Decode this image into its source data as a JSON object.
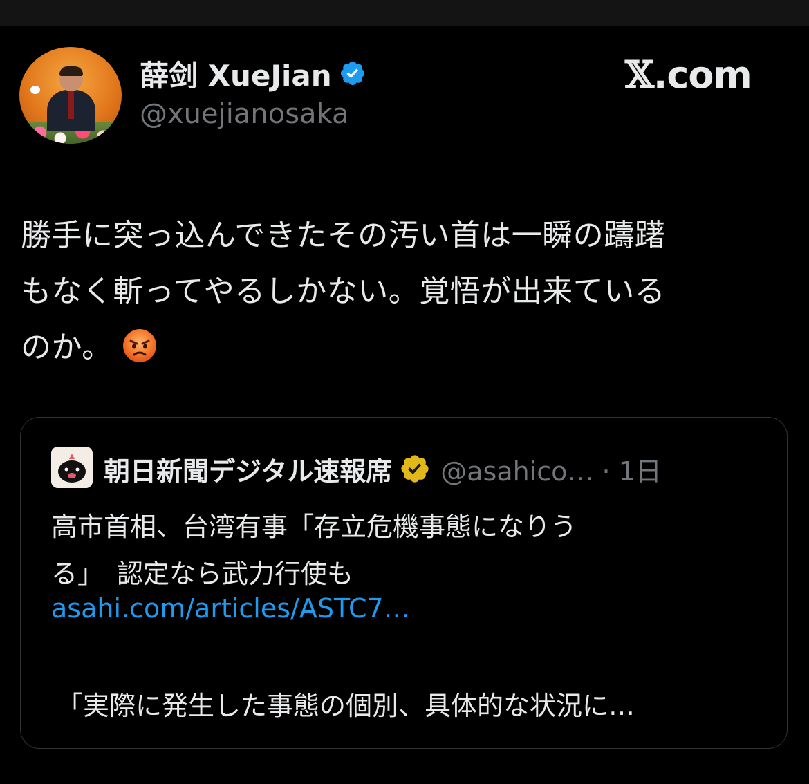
{
  "author": {
    "display_name": "薛剑 XueJian",
    "handle": "@xuejianosaka",
    "verified_icon": "blue-check-icon",
    "avatar_icon": "profile-photo"
  },
  "brand": {
    "label": "X.com",
    "mark": "𝕏",
    "suffix": ".com"
  },
  "post": {
    "lines": [
      "勝手に突っ込んできたその汚い首は一瞬の躊躇",
      "もなく斬ってやるしかない。覚悟が出来ている",
      "のか。"
    ],
    "emoji": "angry-face-icon"
  },
  "quoted_post": {
    "author_name": "朝日新聞デジタル速報席",
    "badge_icon": "gold-check-icon",
    "handle_time": "@asahico… · 1日",
    "text_lines": [
      "高市首相、台湾有事「存立危機事態になりう",
      "る」　認定なら武力行使も"
    ],
    "link": "asahi.com/articles/ASTC7…",
    "excerpt": "「実際に発生した事態の個別、具体的な状況に…"
  },
  "colors": {
    "background": "#000000",
    "text": "#e7e9ea",
    "secondary": "#71767b",
    "link": "#1d9bf0",
    "verified_blue": "#1d9bf0",
    "badge_gold": "#e2b719"
  }
}
